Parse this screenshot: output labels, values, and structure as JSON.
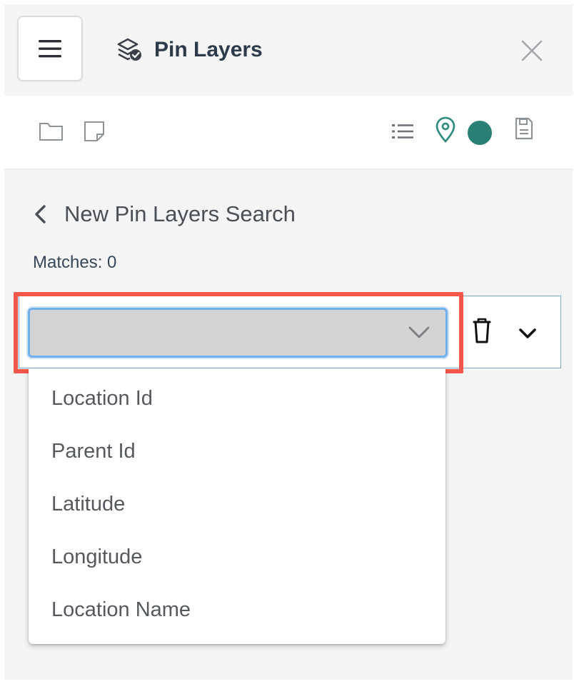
{
  "header": {
    "title": "Pin Layers",
    "icons": {
      "menu": "hamburger-icon",
      "title": "layers-check-icon",
      "close": "close-icon"
    }
  },
  "toolbar": {
    "icons": [
      "folder-icon",
      "note-icon",
      "list-icon",
      "map-pin-icon",
      "color-dot-icon",
      "save-icon"
    ],
    "accent_color": "#2a7f74",
    "pin_color": "#2a8a7c"
  },
  "search": {
    "back_icon": "chevron-left-icon",
    "title": "New Pin Layers Search",
    "matches_text": "Matches: 0"
  },
  "field_row": {
    "select_value": "",
    "options": [
      "Location Id",
      "Parent Id",
      "Latitude",
      "Longitude",
      "Location Name"
    ],
    "icons": [
      "chevron-down-icon",
      "trash-icon",
      "expand-chevron-icon"
    ]
  },
  "colors": {
    "highlight": "#f4564c",
    "focus_ring": "#6fb0ee",
    "title_text": "#2d3a4a"
  }
}
